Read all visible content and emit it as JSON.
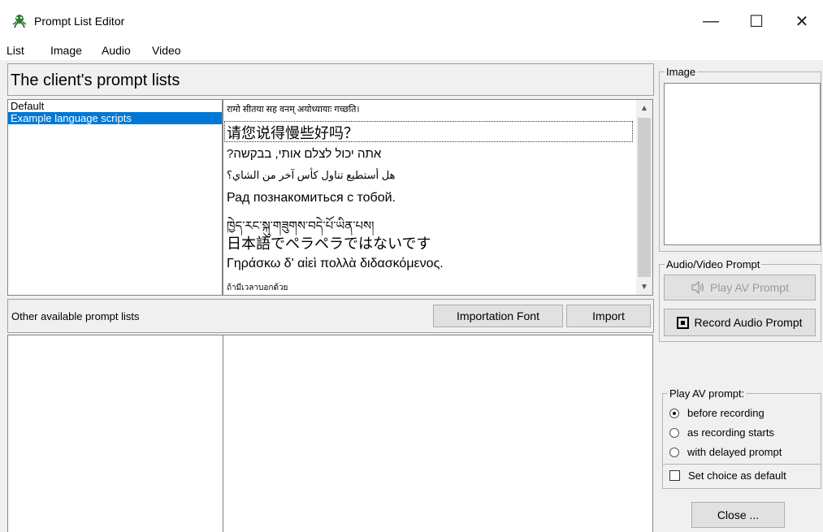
{
  "window": {
    "title": "Prompt List Editor",
    "minimize_glyph": "—",
    "maximize_glyph": "☐",
    "close_glyph": "✕"
  },
  "menu": [
    "List",
    "Image",
    "Audio",
    "Video"
  ],
  "client_panel": {
    "title": "The client's prompt lists"
  },
  "prompt_lists": [
    {
      "label": "Default",
      "selected": false
    },
    {
      "label": "Example language scripts",
      "selected": true
    }
  ],
  "prompts": [
    "रामो सीतया सह वनम् अयोध्यायाः गच्छति।",
    "请您说得慢些好吗？",
    "?אתה יכול לצלם אותי, בבקשה",
    "هل أستطيع تناول كأس آخر من الشاي؟",
    "Рад познакомиться с тобой.",
    "ཁྱེད་རང་སྐུ་གཟུགས་བདེ་པོ་ཡིན་པས།",
    "日本語でペラペラではないです",
    "Γηράσκω δ' αἰεὶ πολλὰ διδασκόμενος.",
    "ถ้ามีเวลาบอกด้วย"
  ],
  "other_panel": {
    "label": "Other available prompt lists",
    "import_font_label": "Importation Font",
    "import_label": "Import"
  },
  "image_group": {
    "caption": "Image"
  },
  "av_group": {
    "caption": "Audio/Video Prompt",
    "play_label": "Play AV Prompt",
    "record_label": "Record Audio Prompt"
  },
  "play_av_group": {
    "caption": "Play AV prompt:",
    "options": [
      {
        "label": "before recording",
        "checked": true
      },
      {
        "label": "as recording starts",
        "checked": false
      },
      {
        "label": "with delayed prompt",
        "checked": false
      }
    ],
    "default_checkbox_label": "Set choice as default",
    "default_checked": false
  },
  "close_label": "Close ..."
}
